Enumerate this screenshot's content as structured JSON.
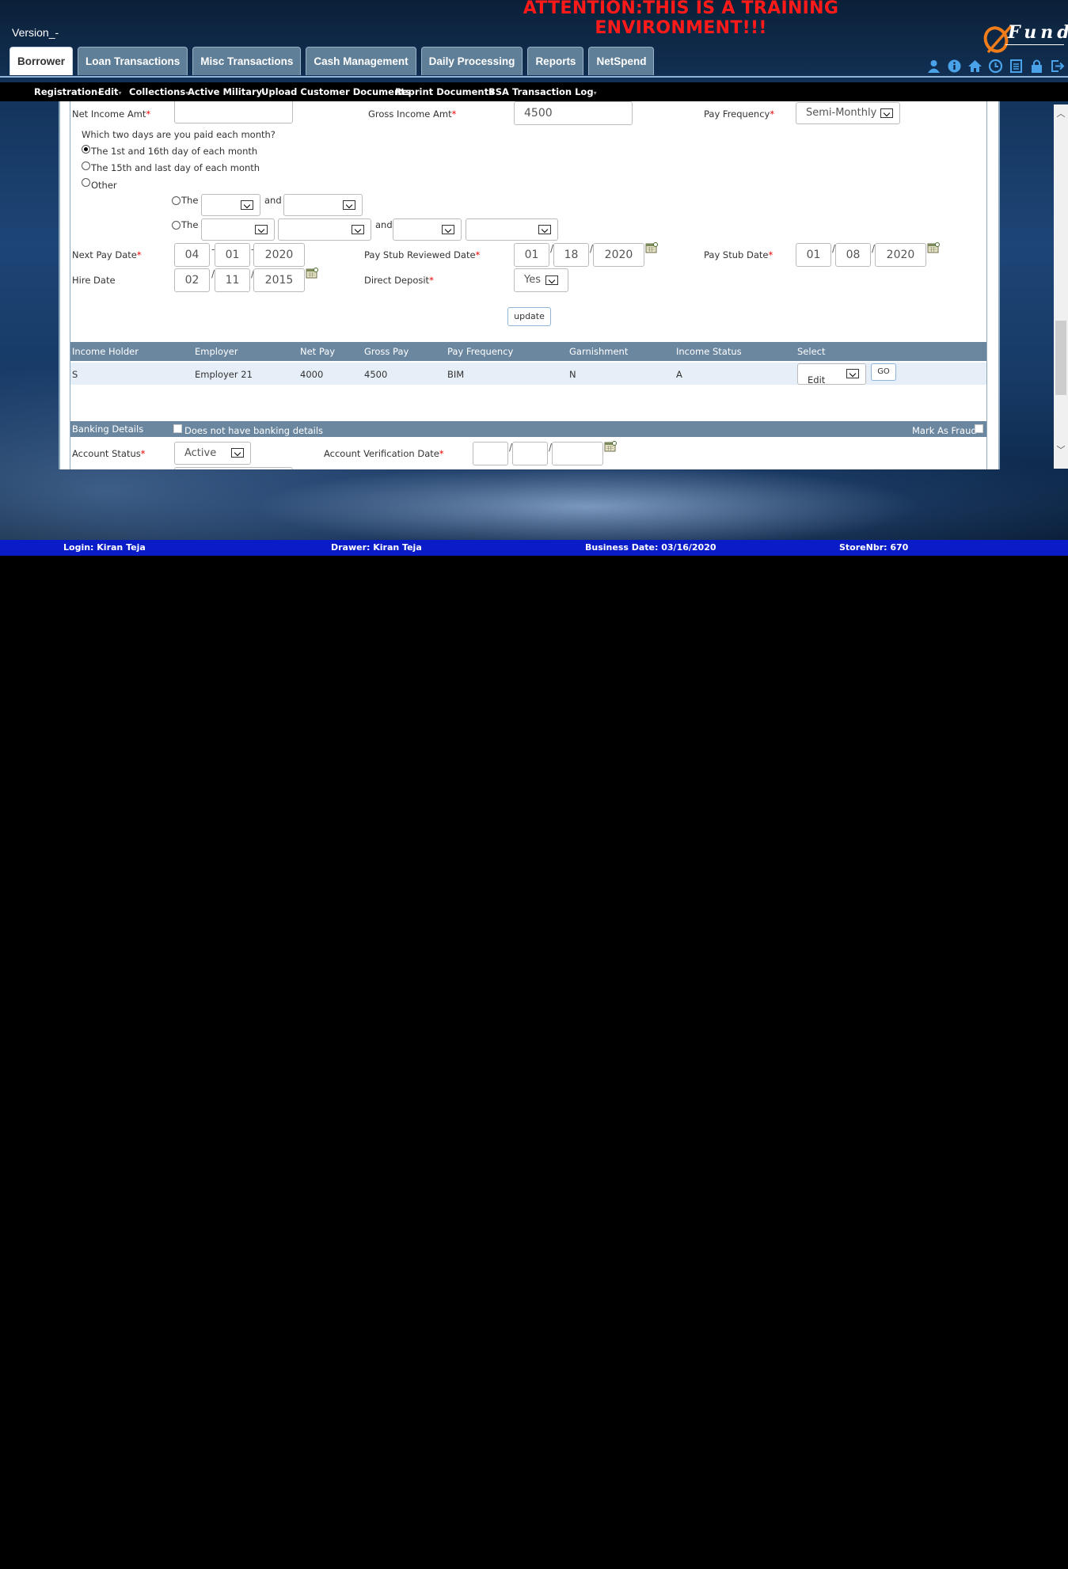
{
  "banner": {
    "attention": "ATTENTION:THIS IS A TRAINING ENVIRONMENT!!!",
    "version": "Version_-"
  },
  "logo": {
    "text": "Fund"
  },
  "tabs": [
    "Borrower",
    "Loan Transactions",
    "Misc Transactions",
    "Cash Management",
    "Daily Processing",
    "Reports",
    "NetSpend"
  ],
  "header_icons": [
    "user-icon",
    "info-icon",
    "home-icon",
    "clock-icon",
    "document-icon",
    "lock-icon",
    "logout-icon"
  ],
  "subnav": [
    "Registration",
    "Edit",
    "Collections",
    "Active Military",
    "Upload Customer Documents",
    "Reprint Documents",
    "BSA Transaction Log"
  ],
  "income": {
    "net_income_label": "Net Income Amt",
    "net_income_value": "",
    "gross_income_label": "Gross Income Amt",
    "gross_income_value": "4500",
    "pay_frequency_label": "Pay Frequency",
    "pay_frequency_value": "Semi-Monthly",
    "question": "Which two days are you paid each month?",
    "options": [
      "The 1st and 16th day of each month",
      "The 15th and last day of each month",
      "Other"
    ],
    "selected_option": 0,
    "the_label": "The",
    "and_label": "and",
    "next_pay_date_label": "Next Pay Date",
    "next_pay_date": {
      "mm": "04",
      "dd": "01",
      "yyyy": "2020",
      "sep": "-"
    },
    "pay_stub_reviewed_label": "Pay Stub Reviewed Date",
    "pay_stub_reviewed": {
      "mm": "01",
      "dd": "18",
      "yyyy": "2020",
      "sep": "/"
    },
    "pay_stub_date_label": "Pay Stub Date",
    "pay_stub_date": {
      "mm": "01",
      "dd": "08",
      "yyyy": "2020",
      "sep": "/"
    },
    "hire_date_label": "Hire Date",
    "hire_date": {
      "mm": "02",
      "dd": "11",
      "yyyy": "2015",
      "sep": "/"
    },
    "direct_deposit_label": "Direct Deposit",
    "direct_deposit_value": "Yes",
    "update_label": "update"
  },
  "income_table": {
    "headers": [
      "Income Holder",
      "Employer",
      "Net Pay",
      "Gross Pay",
      "Pay Frequency",
      "Garnishment",
      "Income Status",
      "Select"
    ],
    "rows": [
      {
        "holder": "S",
        "employer": "Employer 21",
        "net": "4000",
        "gross": "4500",
        "freq": "BIM",
        "garn": "N",
        "status": "A",
        "select": "Edit",
        "go": "GO"
      }
    ]
  },
  "banking": {
    "title": "Banking Details",
    "no_banking_label": "Does not have banking details",
    "mark_fraud_label": "Mark As Fraud",
    "account_status_label": "Account Status",
    "account_status_value": "Active",
    "verification_date_label": "Account Verification Date"
  },
  "status_bar": {
    "login": "Login: Kiran Teja",
    "drawer": "Drawer: Kiran Teja",
    "business_date": "Business Date: 03/16/2020",
    "store": "StoreNbr: 670"
  },
  "colors": {
    "attention": "#ff1a1a",
    "tab": "#5f7e97",
    "table_header": "#6b87a0",
    "status_bar": "#0a1cc8",
    "required": "#e00000"
  }
}
